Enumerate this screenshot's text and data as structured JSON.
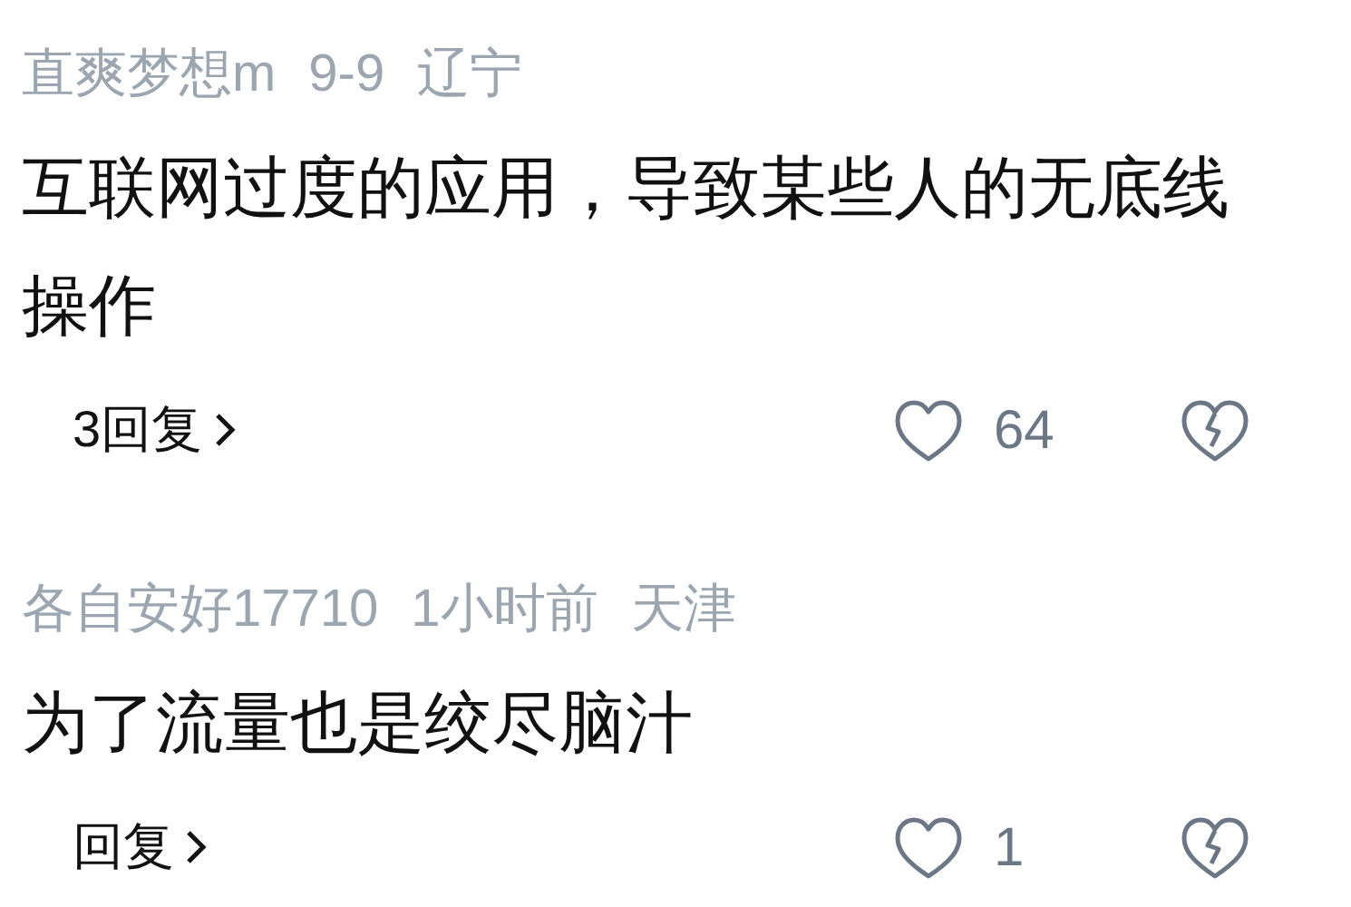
{
  "comments": [
    {
      "user": "直爽梦想m",
      "time": "9-9",
      "location": "辽宁",
      "text": "互联网过度的应用，导致某些人的无底线操作",
      "replies": "3回复",
      "likes": "64"
    },
    {
      "user": "各自安好17710",
      "time": "1小时前",
      "location": "天津",
      "text": "为了流量也是绞尽脑汁",
      "replies": "回复",
      "likes": "1"
    }
  ]
}
